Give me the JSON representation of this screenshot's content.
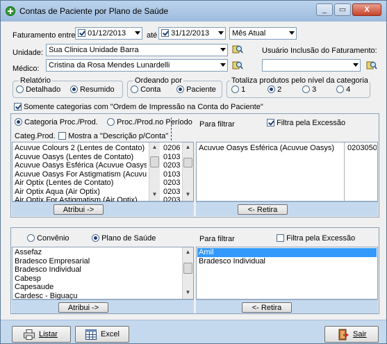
{
  "window": {
    "title": "Contas de Paciente por Plano de Saúde",
    "controls": [
      "_",
      "▭",
      "X"
    ]
  },
  "filters": {
    "faturamento_label": "Faturamento entre:",
    "date_start": "01/12/2013",
    "date_start_checked": true,
    "ate_label": "até",
    "date_end": "31/12/2013",
    "date_end_checked": true,
    "period_select": "Mês Atual",
    "unidade_label": "Unidade:",
    "unidade_value": "Sua Clinica Unidade Barra",
    "medico_label": "Médico:",
    "medico_value": "Cristina da Rosa Mendes Lunardelli",
    "usuario_label": "Usuário Inclusão do Faturamento:",
    "usuario_value": ""
  },
  "relatorio": {
    "title": "Relatório",
    "options": [
      "Detalhado",
      "Resumido"
    ],
    "selected": "Resumido"
  },
  "ordenando": {
    "title": "Ordeando por",
    "options": [
      "Conta",
      "Paciente"
    ],
    "selected": "Paciente"
  },
  "totaliza": {
    "title": "Totaliza produtos pelo nível da categoria",
    "options": [
      "1",
      "2",
      "3",
      "4"
    ],
    "selected": "2"
  },
  "somente_label": "Somente categorias com \"Ordem de Impressão na Conta do Paciente\"",
  "somente_checked": true,
  "categorias": {
    "mode_options": [
      "Categoria Proc./Prod.",
      "Proc./Prod.no Período"
    ],
    "mode_selected": "Categoria Proc./Prod.",
    "categ_label": "Categ.Prod.",
    "mostra_label": "Mostra a \"Descrição p/Conta\"",
    "mostra_checked": false,
    "items": [
      {
        "name": "Acuvue Colours 2 (Lentes de Contato)",
        "code": "0206"
      },
      {
        "name": "Acuvue Oasys (Lentes de Contato)",
        "code": "0103"
      },
      {
        "name": "Acuvue Oasys Esférica (Acuvue Oasys)",
        "code": "0203"
      },
      {
        "name": "Acuvue Oasys For Astigmatism (Acuvue",
        "code": "0103"
      },
      {
        "name": "Air Optix (Lentes de Contato)",
        "code": "0203"
      },
      {
        "name": "Air Optix Aqua (Air Optix)",
        "code": "0203"
      },
      {
        "name": "Air Optix For Astigmatism (Air Optix)",
        "code": "0203"
      }
    ],
    "atribui_label": "Atribui ->",
    "filtrar_label": "Para filtrar",
    "filtra_excecao_label": "Filtra pela Excessão",
    "filtra_excecao_checked": true,
    "selected_items": [
      {
        "name": "Acuvue Oasys Esférica (Acuvue Oasys)",
        "code": "0203050"
      }
    ],
    "retira_label": "<- Retira"
  },
  "planos": {
    "mode_options": [
      "Convênio",
      "Plano de Saúde"
    ],
    "mode_selected": "Plano de Saúde",
    "items": [
      "Assefaz",
      "Bradesco Empresarial",
      "Bradesco Individual",
      "Cabesp",
      "Capesaude",
      "Cardesc - Biguaçu"
    ],
    "atribui_label": "Atribui ->",
    "filtrar_label": "Para filtrar",
    "filtra_excecao_label": "Filtra pela Excessão",
    "filtra_excecao_checked": false,
    "selected_items": [
      "Amil",
      "Bradesco Individual"
    ],
    "highlighted": "Amil",
    "retira_label": "<- Retira"
  },
  "footer": {
    "listar_label": "Listar",
    "excel_label": "Excel",
    "sair_label": "Sair"
  }
}
